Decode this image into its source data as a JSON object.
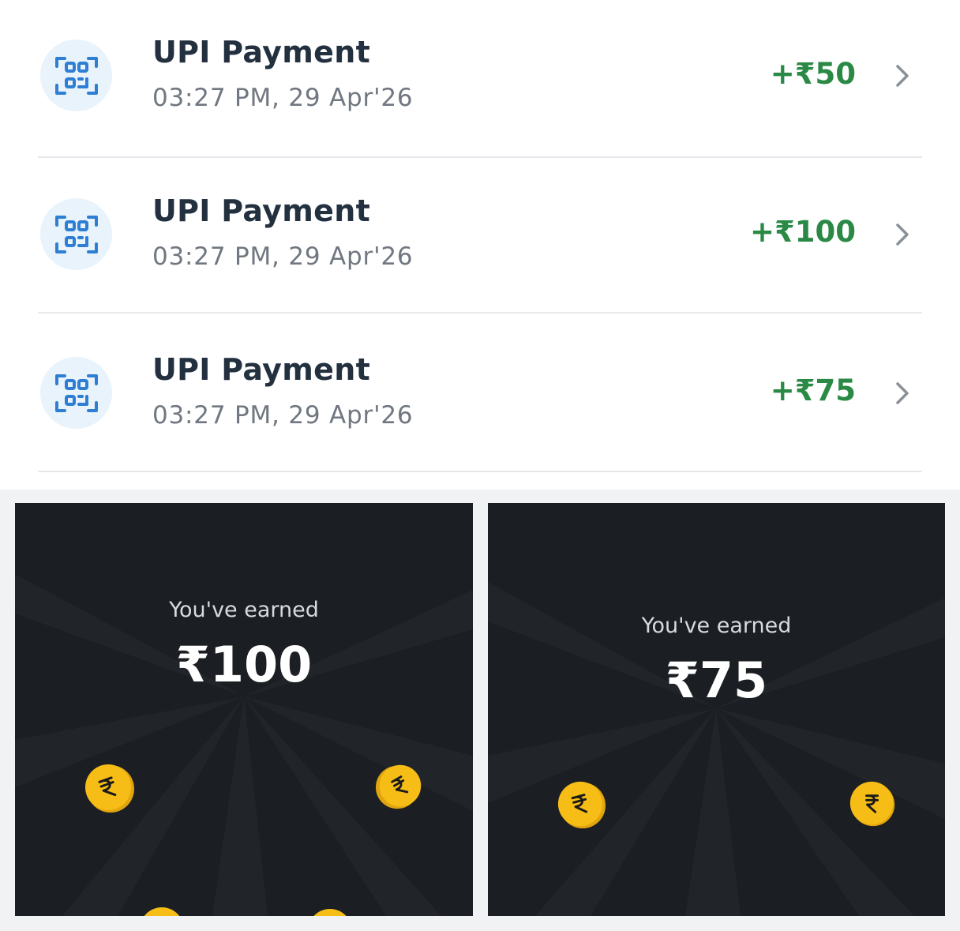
{
  "transactions": [
    {
      "title": "UPI Payment",
      "datetime": "03:27 PM, 29 Apr'26",
      "amount": "+₹50",
      "icon": "qr-scan-icon"
    },
    {
      "title": "UPI Payment",
      "datetime": "03:27 PM, 29 Apr'26",
      "amount": "+₹100",
      "icon": "qr-scan-icon"
    },
    {
      "title": "UPI Payment",
      "datetime": "03:27 PM, 29 Apr'26",
      "amount": "+₹75",
      "icon": "qr-scan-icon"
    }
  ],
  "reward_cards": [
    {
      "label": "You've earned",
      "amount": "₹100"
    },
    {
      "label": "You've earned",
      "amount": "₹75"
    }
  ],
  "colors": {
    "amount_green": "#2a8a45",
    "title_text": "#233040",
    "subtitle_text": "#707780",
    "icon_blue": "#2e7fd3",
    "icon_bg": "#e8f3fc",
    "card_bg": "#1b1e22",
    "coin_yellow": "#f6bd16"
  },
  "coin_icon": "rupee-coin-icon",
  "chevron_icon": "chevron-right-icon"
}
